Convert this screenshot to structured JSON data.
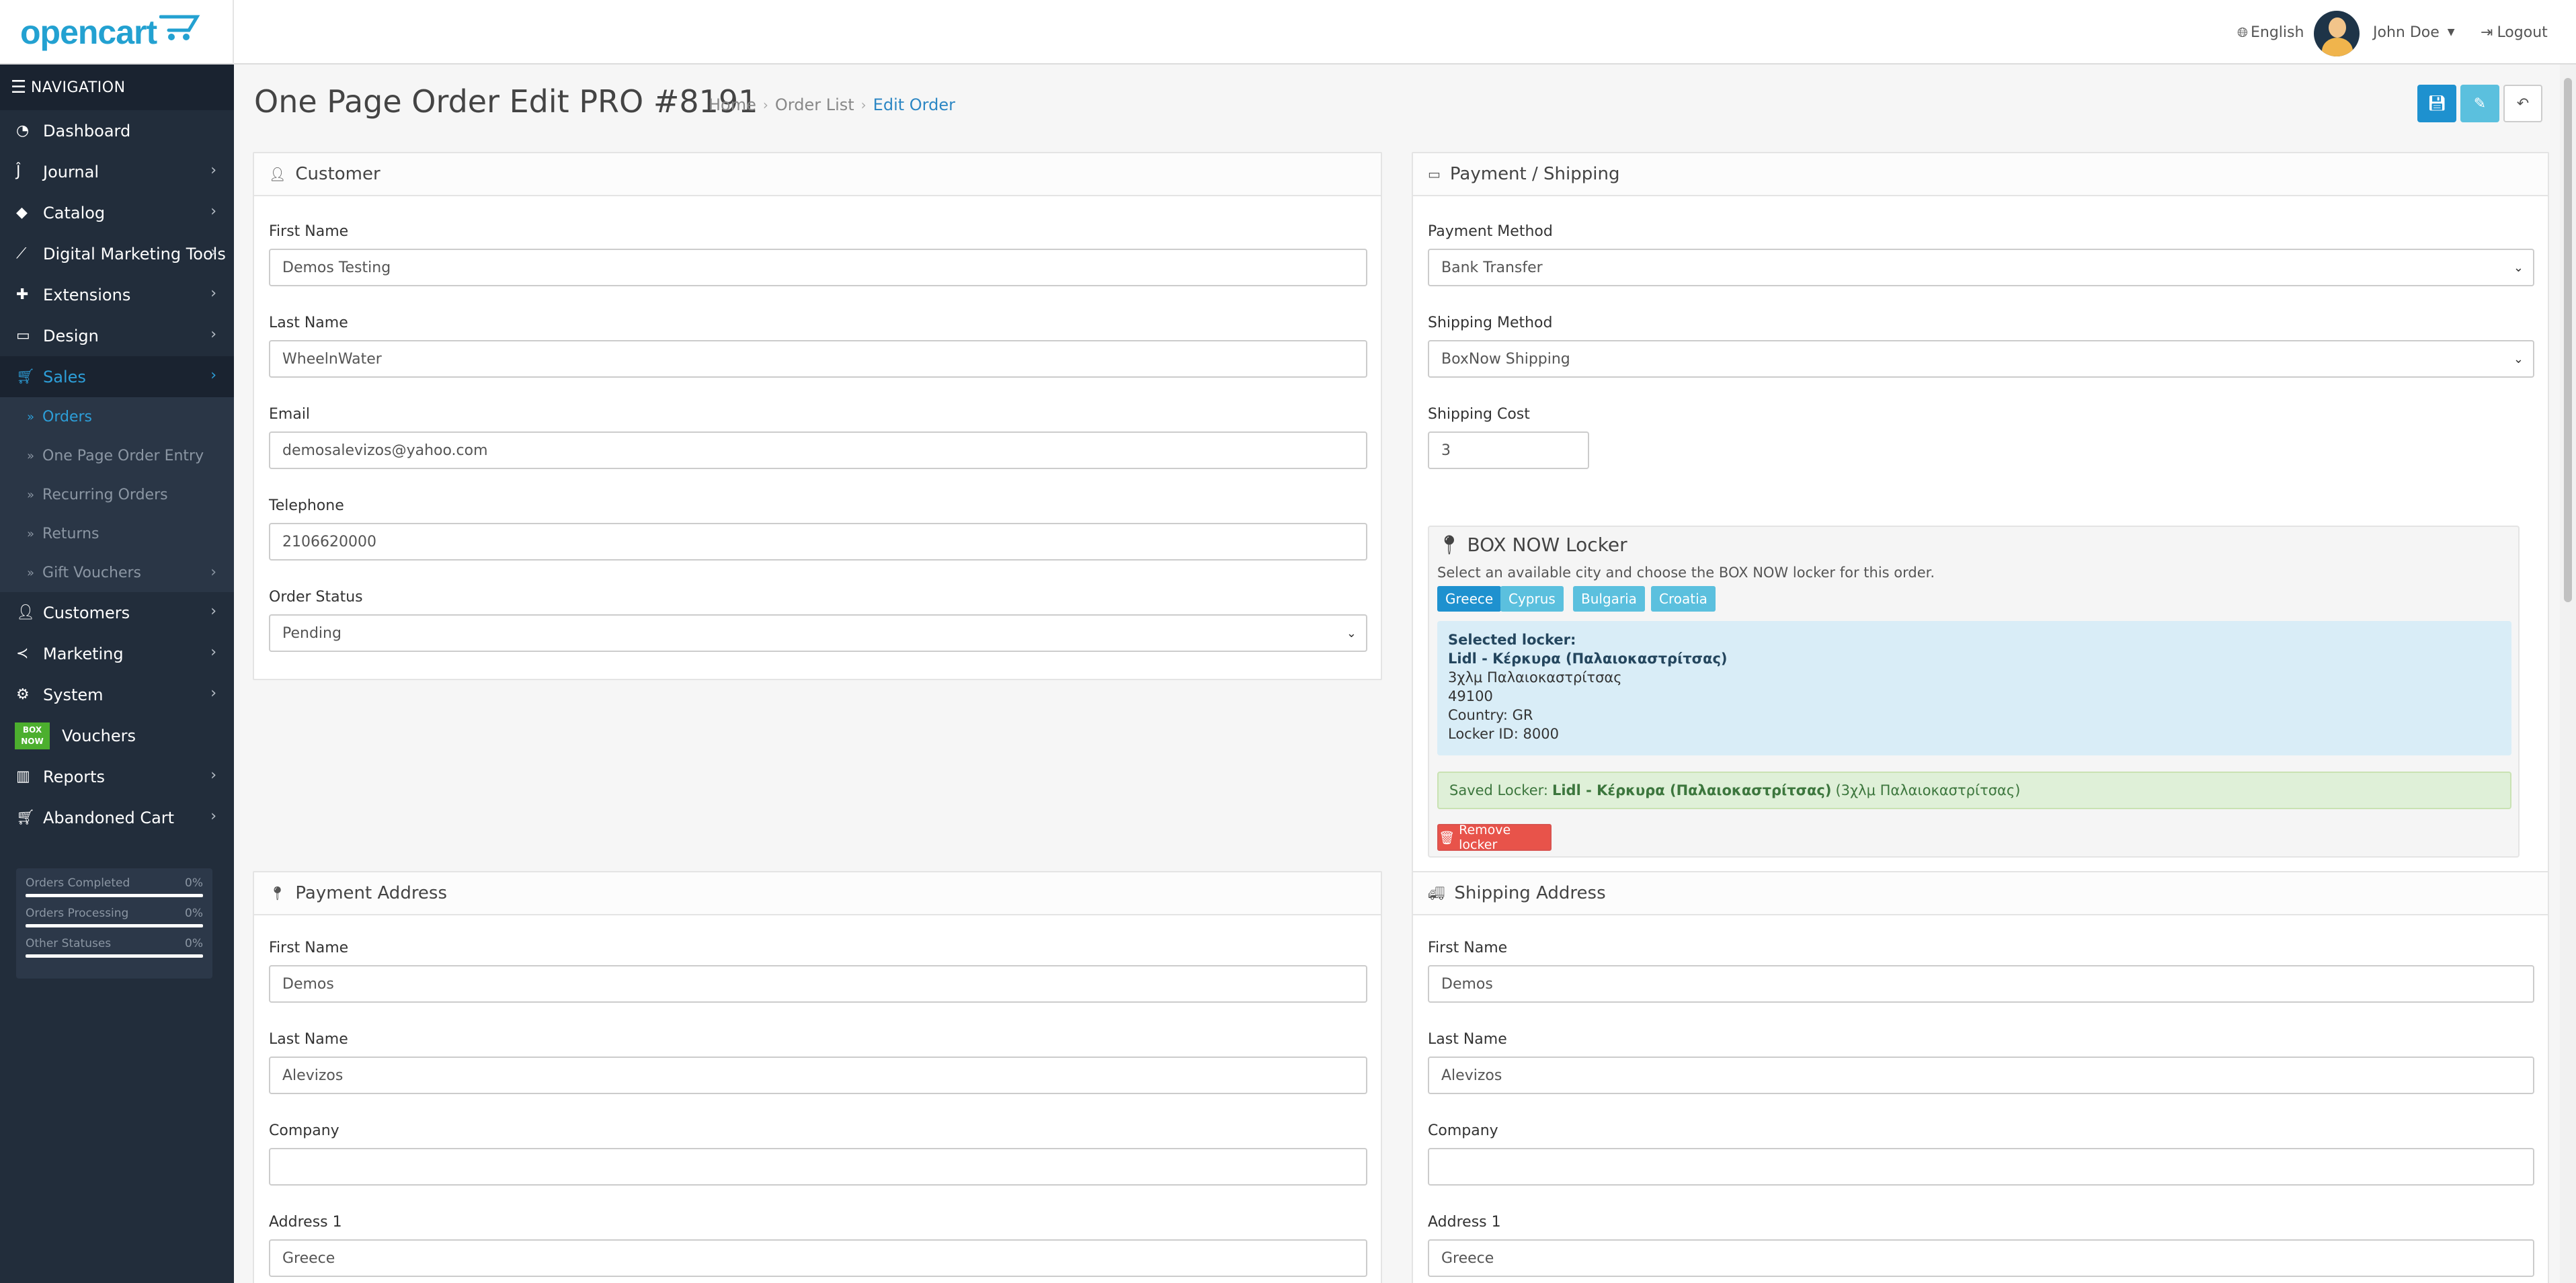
{
  "header": {
    "logo_text": "opencart",
    "language": "English",
    "user_name": "John Doe",
    "logout": "Logout"
  },
  "sidebar": {
    "heading": "NAVIGATION",
    "items": [
      {
        "label": "Dashboard",
        "icon": "dashboard-icon"
      },
      {
        "label": "Journal",
        "icon": "journal-icon"
      },
      {
        "label": "Catalog",
        "icon": "tags-icon"
      },
      {
        "label": "Digital Marketing Tools",
        "icon": "line-chart-icon"
      },
      {
        "label": "Extensions",
        "icon": "puzzle-icon"
      },
      {
        "label": "Design",
        "icon": "monitor-icon"
      },
      {
        "label": "Sales",
        "icon": "cart-icon"
      }
    ],
    "sales_sub": [
      {
        "label": "Orders"
      },
      {
        "label": "One Page Order Entry"
      },
      {
        "label": "Recurring Orders"
      },
      {
        "label": "Returns"
      },
      {
        "label": "Gift Vouchers"
      }
    ],
    "items2": [
      {
        "label": "Customers",
        "icon": "user-icon"
      },
      {
        "label": "Marketing",
        "icon": "share-icon"
      },
      {
        "label": "System",
        "icon": "cog-icon"
      },
      {
        "label": "Vouchers",
        "icon": "boxnow-logo"
      },
      {
        "label": "Reports",
        "icon": "bar-chart-icon"
      },
      {
        "label": "Abandoned Cart",
        "icon": "cart-icon"
      }
    ],
    "boxnow_logo_text": [
      "BOX",
      "NOW"
    ],
    "stats": [
      {
        "label": "Orders Completed",
        "value": "0%"
      },
      {
        "label": "Orders Processing",
        "value": "0%"
      },
      {
        "label": "Other Statuses",
        "value": "0%"
      }
    ]
  },
  "page": {
    "title": "One Page Order Edit PRO #8191",
    "breadcrumb": [
      "Home",
      "Order List",
      "Edit Order"
    ]
  },
  "customer": {
    "heading": "Customer",
    "first_name_label": "First Name",
    "first_name": "Demos Testing",
    "last_name_label": "Last Name",
    "last_name": "WheelnWater",
    "email_label": "Email",
    "email": "demosalevizos@yahoo.com",
    "telephone_label": "Telephone",
    "telephone": "2106620000",
    "status_label": "Order Status",
    "status": "Pending"
  },
  "payment_shipping": {
    "heading": "Payment / Shipping",
    "payment_method_label": "Payment Method",
    "payment_method": "Bank Transfer",
    "shipping_method_label": "Shipping Method",
    "shipping_method": "BoxNow Shipping",
    "shipping_cost_label": "Shipping Cost",
    "shipping_cost": "3"
  },
  "boxnow": {
    "title": "BOX NOW Locker",
    "description": "Select an available city and choose the BOX NOW locker for this order.",
    "countries": [
      "Greece",
      "Cyprus",
      "Bulgaria",
      "Croatia"
    ],
    "selected_heading": "Selected locker:",
    "locker_name": "Lidl - Κέρκυρα (Παλαιοκαστρίτσας)",
    "locker_address": "3χλμ Παλαιοκαστρίτσας",
    "locker_postcode": "49100",
    "locker_country": "Country: GR",
    "locker_id": "Locker ID: 8000",
    "saved_label": "Saved Locker:",
    "saved_name": "Lidl - Κέρκυρα (Παλαιοκαστρίτσας)",
    "saved_address": "(3χλμ Παλαιοκαστρίτσας)",
    "remove_label": "Remove locker"
  },
  "payment_address": {
    "heading": "Payment Address",
    "first_name_label": "First Name",
    "first_name": "Demos",
    "last_name_label": "Last Name",
    "last_name": "Alevizos",
    "company_label": "Company",
    "company": "",
    "address1_label": "Address 1",
    "address1": "Greece"
  },
  "shipping_address": {
    "heading": "Shipping Address",
    "first_name_label": "First Name",
    "first_name": "Demos",
    "last_name_label": "Last Name",
    "last_name": "Alevizos",
    "company_label": "Company",
    "company": "",
    "address1_label": "Address 1",
    "address1": "Greece"
  },
  "colors": {
    "sidebar_bg": "#222d3b",
    "accent": "#1e91cf",
    "logo": "#23a1d1"
  }
}
